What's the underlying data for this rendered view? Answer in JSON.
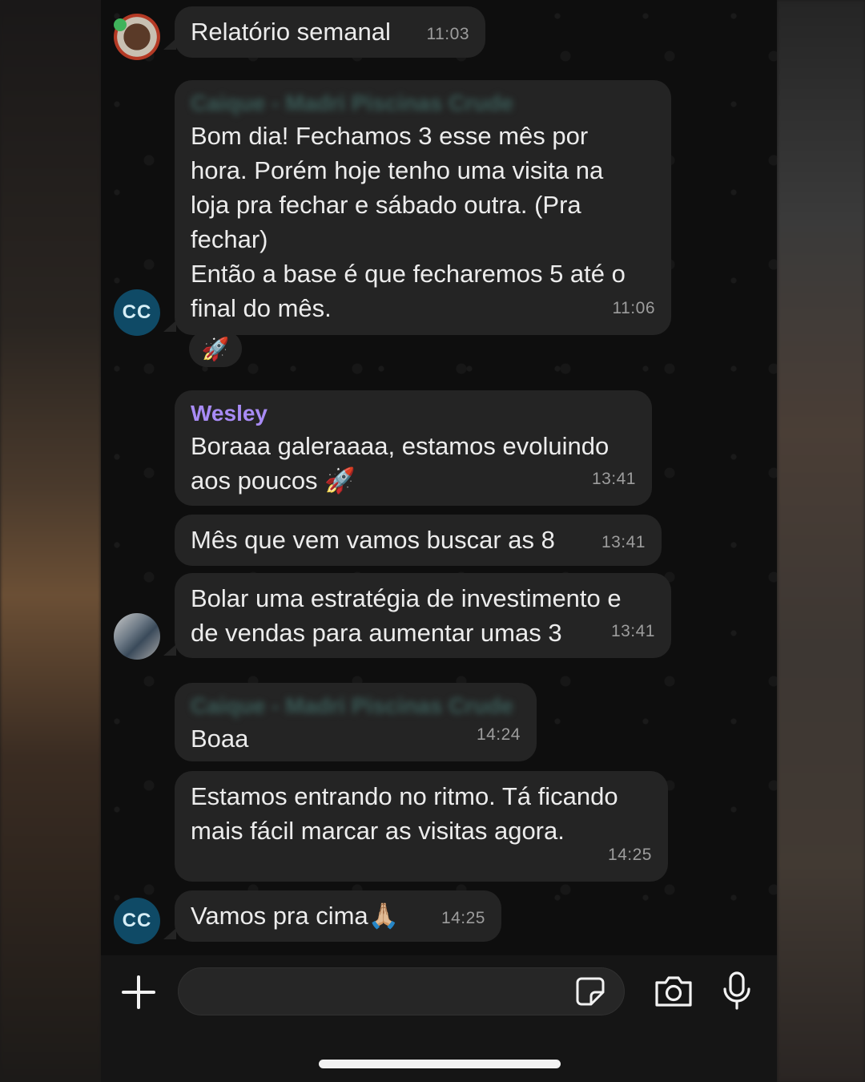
{
  "chat": {
    "messages": [
      {
        "text": "Relatório semanal",
        "time": "11:03"
      },
      {
        "sender": "Caique - Madri Piscinas Crude",
        "text": "Bom dia! Fechamos 3 esse mês por\nhora. Porém hoje tenho uma visita na\nloja pra fechar e sábado outra. (Pra\nfechar)\nEntão a base é que fecharemos 5 até o\nfinal do mês.",
        "time": "11:06",
        "reaction": "🚀"
      },
      {
        "sender": "Wesley",
        "sender_color": "#a88bf5",
        "text": "Boraaa galeraaaa, estamos evoluindo\naos poucos 🚀",
        "time": "13:41"
      },
      {
        "text": "Mês que vem vamos buscar as 8",
        "time": "13:41"
      },
      {
        "text": "Bolar uma estratégia de investimento e\nde vendas para aumentar umas 3",
        "time": "13:41"
      },
      {
        "sender": "Caique - Madri Piscinas Crude",
        "text": "Boaa",
        "time": "14:24"
      },
      {
        "text": "Estamos entrando no ritmo. Tá ficando\nmais fácil marcar as visitas agora.",
        "time": "14:25"
      },
      {
        "text": "Vamos pra cima🙏🏼",
        "time": "14:25"
      }
    ],
    "avatars": {
      "cc_initials": "CC"
    }
  },
  "composer": {
    "input_value": ""
  },
  "colors": {
    "bubble": "#242424",
    "avatar_cc": "#0f4a66",
    "sender_wesley": "#a88bf5"
  }
}
